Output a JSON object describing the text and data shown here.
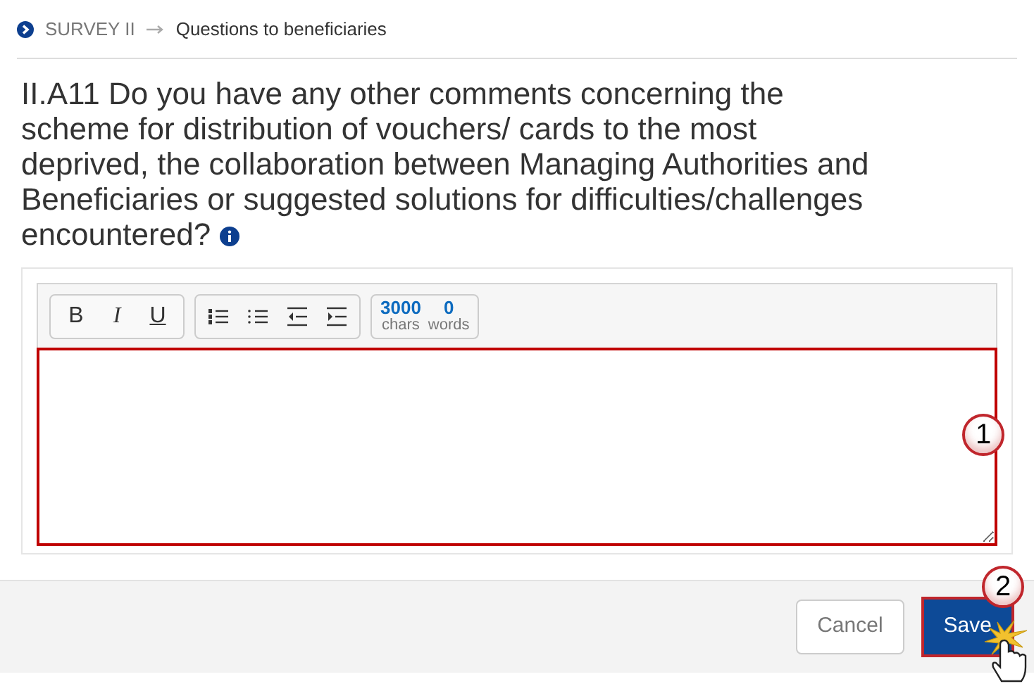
{
  "breadcrumb": [
    {
      "label": "SURVEY II",
      "current": false
    },
    {
      "label": "Questions to beneficiaries",
      "current": true
    }
  ],
  "question": "II.A11 Do you have any other comments concerning the scheme for distribution of vouchers/ cards to the most deprived, the collaboration between Managing Authorities and Beneficiaries or suggested solutions for difficulties/challenges encountered?",
  "editor": {
    "format_buttons": [
      {
        "kind": "bold",
        "label": "B"
      },
      {
        "kind": "italic",
        "label": "I"
      },
      {
        "kind": "underline",
        "label": "U"
      }
    ],
    "list_buttons": [
      {
        "kind": "numbered-list"
      },
      {
        "kind": "bulleted-list"
      },
      {
        "kind": "outdent"
      },
      {
        "kind": "indent"
      }
    ],
    "counter": {
      "chars": "3000",
      "chars_label": "chars",
      "words": "0",
      "words_label": "words"
    },
    "highlighted": true
  },
  "callouts": [
    "1",
    "2"
  ],
  "buttons": [
    {
      "kind": "cancel",
      "label": "Cancel",
      "highlighted": false
    },
    {
      "kind": "save",
      "label": "Save",
      "highlighted": true
    }
  ]
}
